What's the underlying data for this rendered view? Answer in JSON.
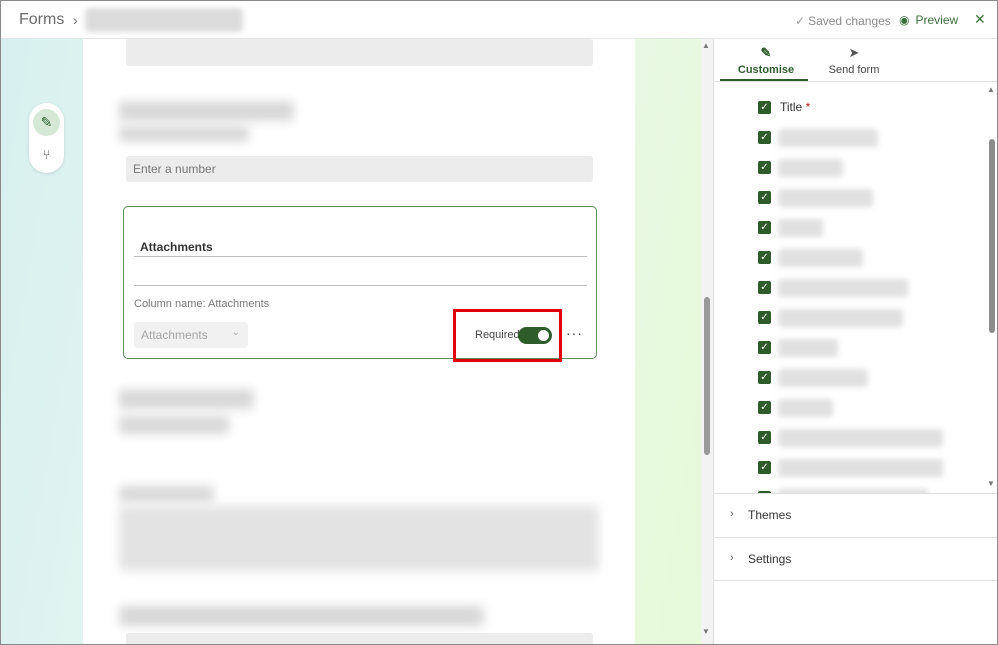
{
  "header": {
    "app_name": "Forms",
    "saved_status": "Saved changes",
    "preview_label": "Preview"
  },
  "form": {
    "number_placeholder": "Enter a number",
    "attachments_card": {
      "title": "Attachments",
      "column_name": "Column name: Attachments",
      "type_dropdown": "Attachments",
      "required_label": "Required",
      "required_on": true
    }
  },
  "panel": {
    "tabs": [
      {
        "label": "Customise",
        "active": true
      },
      {
        "label": "Send form",
        "active": false
      }
    ],
    "fields": [
      {
        "label": "Title",
        "required": true,
        "checked": true
      }
    ],
    "sections": {
      "themes": "Themes",
      "settings": "Settings"
    }
  },
  "colors": {
    "accent": "#2e5d2b",
    "highlight": "#e00000"
  }
}
